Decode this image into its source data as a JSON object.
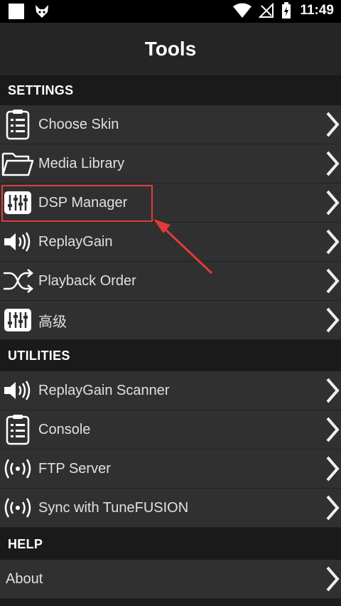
{
  "status": {
    "time": "11:49"
  },
  "header": {
    "title": "Tools"
  },
  "sections": {
    "settings": "SETTINGS",
    "utilities": "UTILITIES",
    "help": "HELP"
  },
  "items": {
    "choose_skin": "Choose Skin",
    "media_library": "Media Library",
    "dsp_manager": "DSP Manager",
    "replaygain": "ReplayGain",
    "playback_order": "Playback Order",
    "advanced": "高级",
    "replaygain_scanner": "ReplayGain Scanner",
    "console": "Console",
    "ftp_server": "FTP Server",
    "sync_tunefusion": "Sync with TuneFUSION",
    "about": "About"
  },
  "colors": {
    "highlight": "#e23b3b",
    "row_bg": "#303030",
    "section_bg": "#1a1a1a"
  }
}
